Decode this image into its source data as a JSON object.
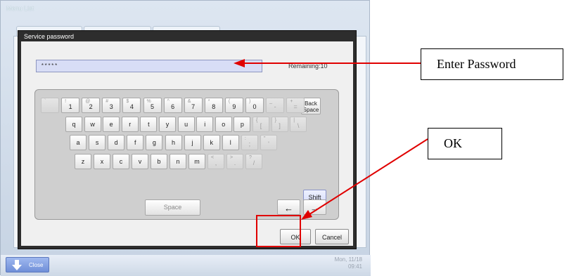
{
  "app": {
    "title": "Menu List"
  },
  "dialog": {
    "title": "Service password",
    "password_value": "*****",
    "remaining": "Remaining:10",
    "ok_label": "OK",
    "cancel_label": "Cancel"
  },
  "keyboard": {
    "row1": [
      {
        "main": "",
        "sub": "`",
        "state": "disabled"
      },
      {
        "main": "1",
        "sub": "!"
      },
      {
        "main": "2",
        "sub": "@"
      },
      {
        "main": "3",
        "sub": "#"
      },
      {
        "main": "4",
        "sub": "$"
      },
      {
        "main": "5",
        "sub": "%"
      },
      {
        "main": "6",
        "sub": "^"
      },
      {
        "main": "7",
        "sub": "&"
      },
      {
        "main": "8",
        "sub": "*"
      },
      {
        "main": "9",
        "sub": "("
      },
      {
        "main": "0",
        "sub": ")"
      },
      {
        "main": "-",
        "sub": "_",
        "state": "disabled"
      },
      {
        "main": "=",
        "sub": "+",
        "state": "disabled"
      }
    ],
    "backspace_label": "Back\nSpace",
    "row2": [
      {
        "main": "q"
      },
      {
        "main": "w"
      },
      {
        "main": "e"
      },
      {
        "main": "r"
      },
      {
        "main": "t"
      },
      {
        "main": "y"
      },
      {
        "main": "u"
      },
      {
        "main": "i"
      },
      {
        "main": "o"
      },
      {
        "main": "p"
      },
      {
        "main": "[",
        "sub": "{",
        "state": "disabled"
      },
      {
        "main": "]",
        "sub": "}",
        "state": "disabled"
      },
      {
        "main": "\\",
        "sub": "|",
        "state": "disabled"
      }
    ],
    "row3": [
      {
        "main": "a"
      },
      {
        "main": "s"
      },
      {
        "main": "d"
      },
      {
        "main": "f"
      },
      {
        "main": "g"
      },
      {
        "main": "h"
      },
      {
        "main": "j"
      },
      {
        "main": "k"
      },
      {
        "main": "l"
      },
      {
        "main": ";",
        "sub": ":",
        "state": "disabled"
      },
      {
        "main": "'",
        "sub": "\"",
        "state": "disabled"
      }
    ],
    "row4": [
      {
        "main": "z"
      },
      {
        "main": "x"
      },
      {
        "main": "c"
      },
      {
        "main": "v"
      },
      {
        "main": "b"
      },
      {
        "main": "n"
      },
      {
        "main": "m"
      },
      {
        "main": ",",
        "sub": "<",
        "state": "disabled"
      },
      {
        "main": ".",
        "sub": ">",
        "state": "disabled"
      },
      {
        "main": "/",
        "sub": "?",
        "state": "disabled"
      }
    ],
    "shift_label": "Shift",
    "space_label": "Space",
    "left_arrow": "←",
    "right_arrow": "→"
  },
  "footer": {
    "close_label": "Close",
    "date": "Mon, 11/18",
    "time": "09:41"
  },
  "annotations": {
    "enter_password": "Enter Password",
    "ok": "OK",
    "color": "#e00000"
  }
}
